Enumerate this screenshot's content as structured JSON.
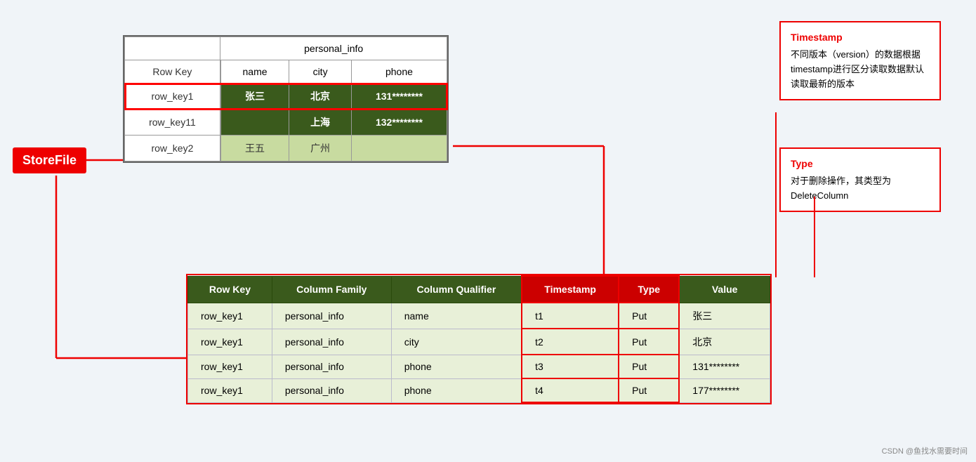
{
  "storefile": {
    "label": "StoreFile"
  },
  "topTable": {
    "cf_header": "personal_info",
    "rowkey_header": "Row Key",
    "col_headers": [
      "name",
      "city",
      "phone"
    ],
    "rows": [
      {
        "key": "row_key1",
        "name": "张三",
        "city": "北京",
        "phone": "131********",
        "style": "green",
        "highlight": true
      },
      {
        "key": "row_key11",
        "name": "",
        "city": "上海",
        "phone": "132********",
        "style": "green",
        "highlight": false
      },
      {
        "key": "row_key2",
        "name": "王五",
        "city": "广州",
        "phone": "",
        "style": "light",
        "highlight": false
      }
    ]
  },
  "bottomTable": {
    "headers": [
      "Row Key",
      "Column Family",
      "Column Qualifier",
      "Timestamp",
      "Type",
      "Value"
    ],
    "rows": [
      {
        "rowkey": "row_key1",
        "cf": "personal_info",
        "cq": "name",
        "ts": "t1",
        "type": "Put",
        "value": "张三"
      },
      {
        "rowkey": "row_key1",
        "cf": "personal_info",
        "cq": "city",
        "ts": "t2",
        "type": "Put",
        "value": "北京"
      },
      {
        "rowkey": "row_key1",
        "cf": "personal_info",
        "cq": "phone",
        "ts": "t3",
        "type": "Put",
        "value": "131********"
      },
      {
        "rowkey": "row_key1",
        "cf": "personal_info",
        "cq": "phone",
        "ts": "t4",
        "type": "Put",
        "value": "177********"
      }
    ]
  },
  "annotations": {
    "timestamp": {
      "title": "Timestamp",
      "body": "不同版本（version）的数据根据timestamp进行区分读取数据默认读取最新的版本"
    },
    "type": {
      "title": "Type",
      "body": "对于删除操作，其类型为DeleteColumn"
    }
  },
  "watermark": "CSDN @鱼找水需要时间"
}
